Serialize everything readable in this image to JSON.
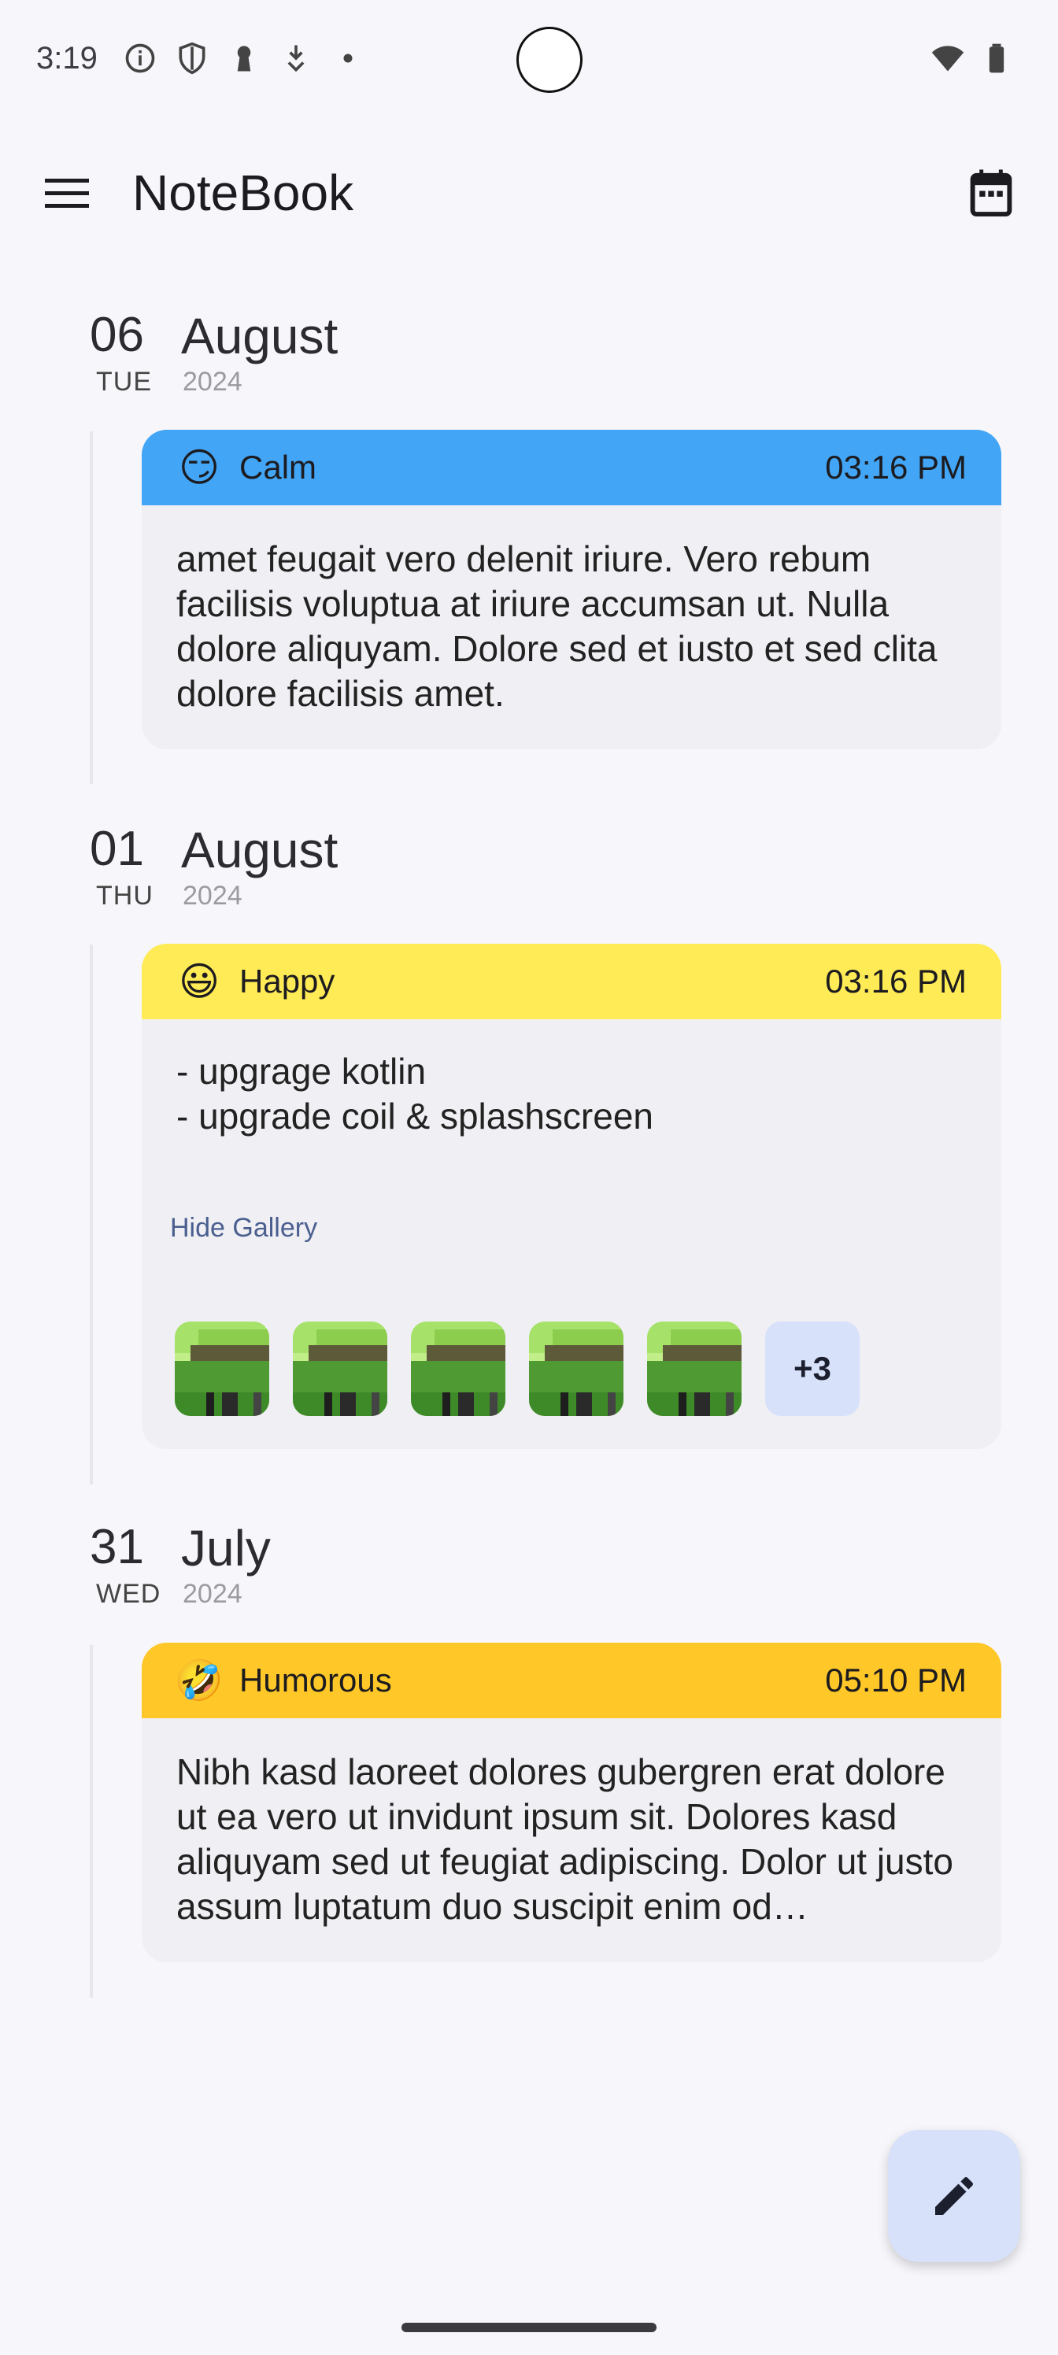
{
  "status_bar": {
    "time": "3:19",
    "icons": [
      "info-icon",
      "shield-icon",
      "keyhole-icon",
      "download-icon",
      "dot-icon"
    ],
    "right_icons": [
      "wifi-icon",
      "battery-icon"
    ]
  },
  "app_bar": {
    "title": "NoteBook",
    "menu_icon": "menu-icon",
    "calendar_icon": "calendar-icon"
  },
  "entries": [
    {
      "day": "06",
      "dow": "TUE",
      "month": "August",
      "year": "2024",
      "mood": "Calm",
      "emoji": "😏",
      "color": "#42a5f5",
      "time": "03:16 PM",
      "text": "amet feugait vero delenit iriure. Vero rebum facilisis voluptua at iriure accumsan ut. Nulla dolore aliquyam. Dolore sed et iusto et sed clita dolore facilisis amet."
    },
    {
      "day": "01",
      "dow": "THU",
      "month": "August",
      "year": "2024",
      "mood": "Happy",
      "emoji": "😃",
      "color": "#ffeb55",
      "time": "03:16 PM",
      "line1": "- upgrage kotlin",
      "line2": "- upgrade coil & splashscreen",
      "gallery_toggle": "Hide Gallery",
      "more_count": "+3"
    },
    {
      "day": "31",
      "dow": "WED",
      "month": "July",
      "year": "2024",
      "mood": "Humorous",
      "emoji": "🤣",
      "color": "#ffc727",
      "time": "05:10 PM",
      "text": "Nibh kasd laoreet dolores gubergren erat dolore ut ea vero ut invidunt ipsum sit. Dolores kasd aliquyam sed ut feugiat adipiscing. Dolor ut justo assum luptatum duo suscipit enim od…"
    }
  ],
  "fab": {
    "icon": "edit-icon"
  }
}
